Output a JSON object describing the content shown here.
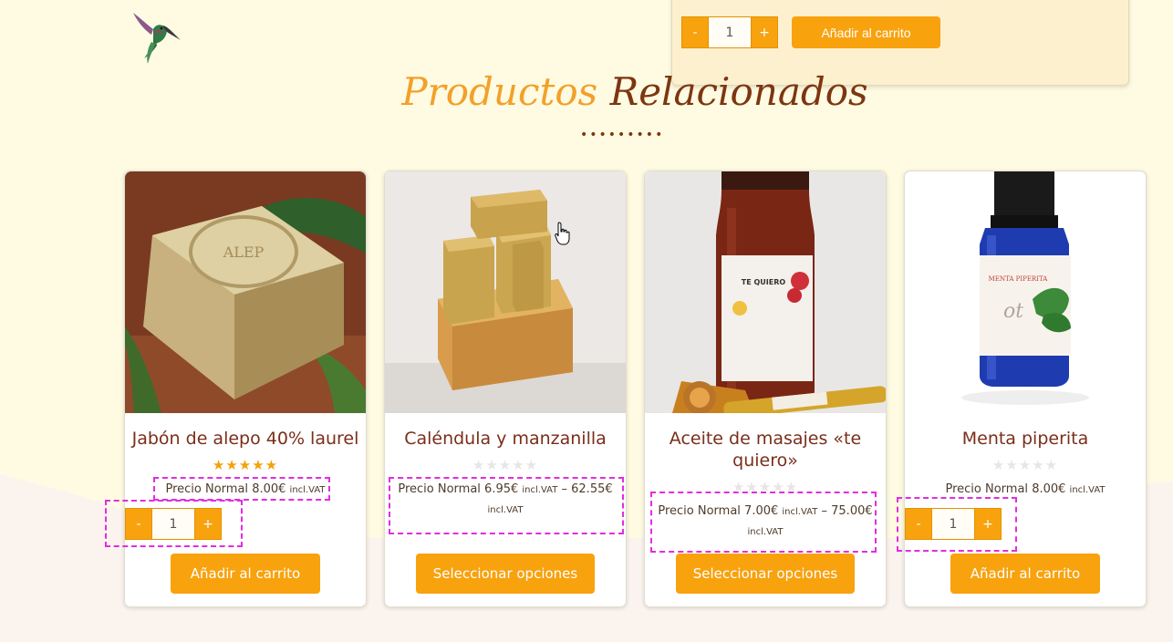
{
  "top_panel": {
    "qty_minus": "-",
    "qty_value": "1",
    "qty_plus": "+",
    "add_to_cart": "Añadir al carrito"
  },
  "section": {
    "title_part1": "Productos",
    "title_part2": "Relacionados",
    "divider": "•••••••••"
  },
  "products": [
    {
      "name": "Jabón de alepo 40% laurel",
      "rating": "★★★★★",
      "price_label": "Precio Normal",
      "price": "8.00€",
      "vat": "incl.VAT",
      "qty_minus": "-",
      "qty_value": "1",
      "qty_plus": "+",
      "button": "Añadir al carrito"
    },
    {
      "name": "Caléndula y manzanilla",
      "rating": "★★★★★",
      "price_label": "Precio Normal",
      "price": "6.95€",
      "vat": "incl.VAT",
      "price_sep": "–",
      "price_max": "62.55€",
      "vat2": "incl.VAT",
      "button": "Seleccionar opciones"
    },
    {
      "name": "Aceite de masajes «te quiero»",
      "rating": "★★★★★",
      "price_label": "Precio Normal",
      "price": "7.00€",
      "vat": "incl.VAT",
      "price_sep": "–",
      "price_max": "75.00€",
      "vat2": "incl.VAT",
      "button": "Seleccionar opciones",
      "label_text": "TE QUIERO"
    },
    {
      "name": "Menta piperita",
      "rating": "★★★★★",
      "price_label": "Precio Normal",
      "price": "8.00€",
      "vat": "incl.VAT",
      "qty_minus": "-",
      "qty_value": "1",
      "qty_plus": "+",
      "button": "Añadir al carrito",
      "label_text": "MENTA PIPERITA"
    }
  ],
  "colors": {
    "page_bg": "#fefbe2",
    "accent": "#f8a20e",
    "title_orange": "#f3a02a",
    "title_brown": "#7d3610",
    "highlight": "#e22de0"
  },
  "icons": [
    "hummingbird-logo",
    "hand-cursor-icon",
    "star-icon"
  ]
}
